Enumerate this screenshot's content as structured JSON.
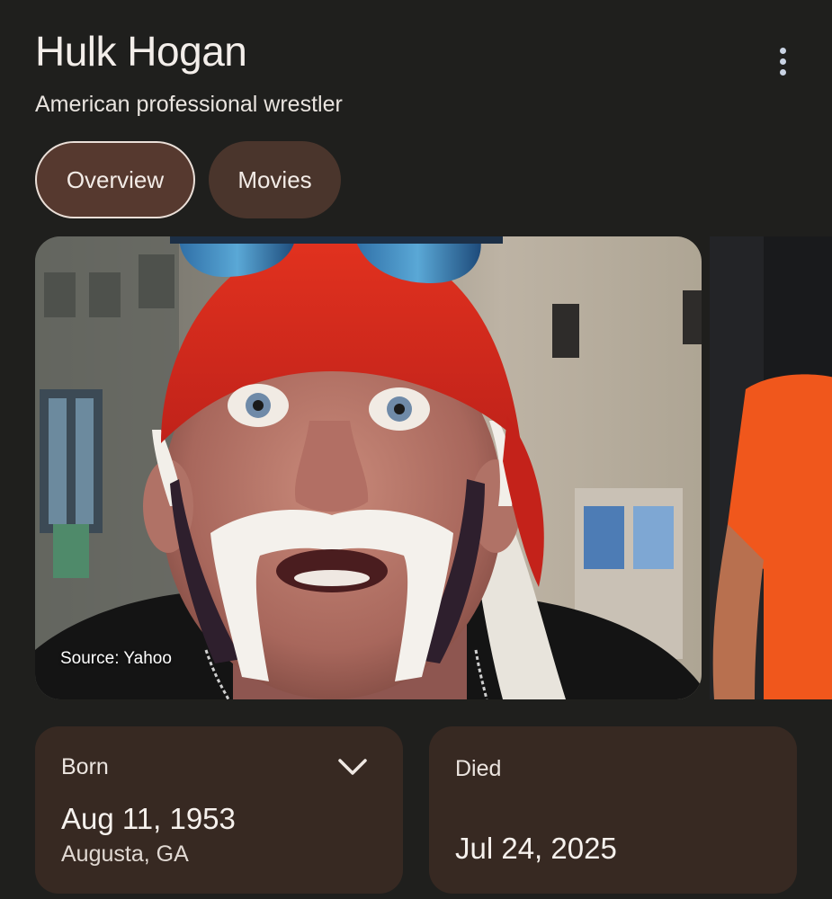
{
  "header": {
    "title": "Hulk Hogan",
    "subtitle": "American professional wrestler",
    "more_icon": "more-vert-icon"
  },
  "tabs": [
    {
      "label": "Overview",
      "selected": true
    },
    {
      "label": "Movies",
      "selected": false
    }
  ],
  "images": {
    "main_source": "Source: Yahoo"
  },
  "facts": {
    "born": {
      "label": "Born",
      "date": "Aug 11, 1953",
      "place": "Augusta, GA",
      "expand_icon": "chevron-down-icon"
    },
    "died": {
      "label": "Died",
      "date": "Jul 24, 2025"
    }
  },
  "colors": {
    "background": "#1f1f1d",
    "chip": "#4a352c",
    "card": "#372922",
    "bandana": "#d8291c",
    "shirt": "#f0571c"
  }
}
